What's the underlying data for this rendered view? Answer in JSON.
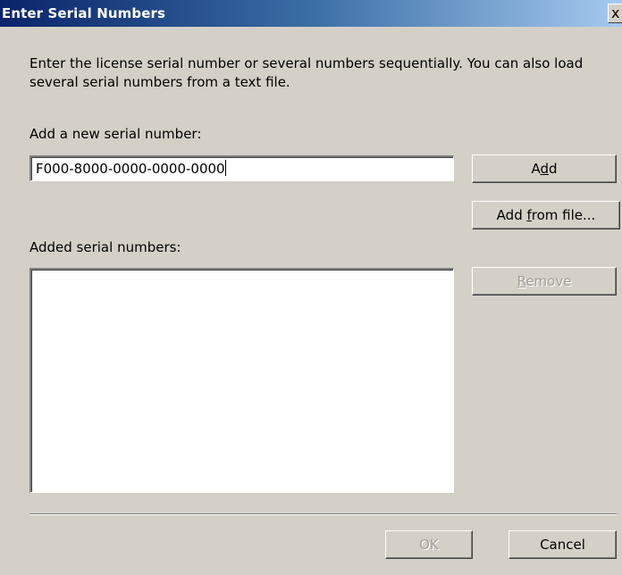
{
  "dialog": {
    "title": "Enter Serial Numbers",
    "close_label": "x",
    "description": "Enter the license serial number or several numbers sequentially. You can also load\nseveral serial numbers from a text file."
  },
  "new_serial": {
    "label": "Add a new serial number:",
    "value": "F000-8000-0000-0000-0000"
  },
  "buttons": {
    "add": {
      "pre": "A",
      "key": "d",
      "post": "d"
    },
    "add_from_file": {
      "pre": "Add ",
      "key": "f",
      "post": "rom file..."
    },
    "remove": {
      "pre": "",
      "key": "R",
      "post": "emove"
    },
    "ok": "OK",
    "cancel": "Cancel"
  },
  "added_serials": {
    "label": "Added serial numbers:",
    "items": []
  }
}
